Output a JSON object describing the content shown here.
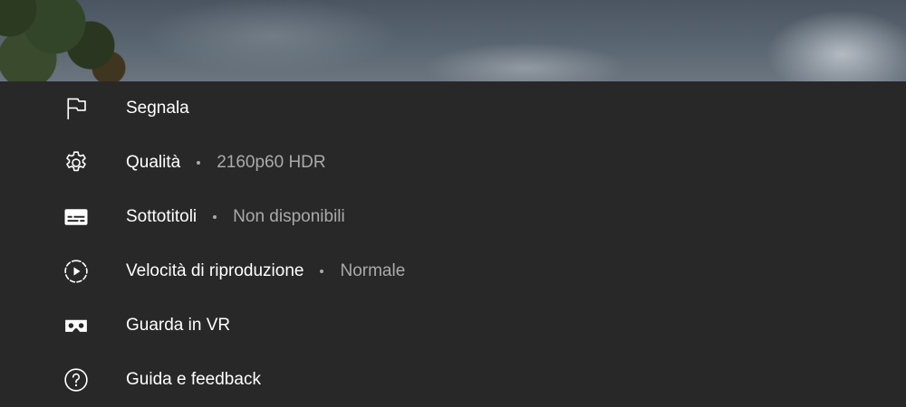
{
  "menu": {
    "items": [
      {
        "label": "Segnala",
        "icon": "flag-icon"
      },
      {
        "label": "Qualità",
        "value": "2160p60 HDR",
        "icon": "gear-icon"
      },
      {
        "label": "Sottotitoli",
        "value": "Non disponibili",
        "icon": "subtitles-icon"
      },
      {
        "label": "Velocità di riproduzione",
        "value": "Normale",
        "icon": "playback-speed-icon"
      },
      {
        "label": "Guarda in VR",
        "icon": "vr-headset-icon"
      },
      {
        "label": "Guida e feedback",
        "icon": "help-icon"
      }
    ]
  },
  "colors": {
    "background": "#282828",
    "text": "#ffffff",
    "secondary_text": "#aaaaaa"
  }
}
